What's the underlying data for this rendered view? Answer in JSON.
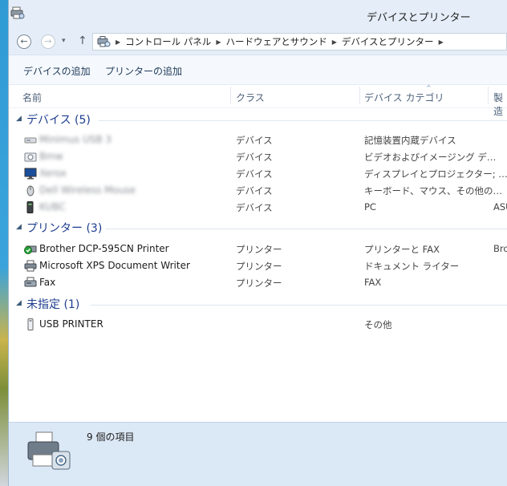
{
  "window": {
    "title": "デバイスとプリンター"
  },
  "nav": {
    "back_glyph": "←",
    "forward_glyph": "→",
    "dropdown_glyph": "▾",
    "up_glyph": "↑",
    "breadcrumb": [
      "コントロール パネル",
      "ハードウェアとサウンド",
      "デバイスとプリンター"
    ],
    "separator_glyph": "▶"
  },
  "commands": {
    "add_device": "デバイスの追加",
    "add_printer": "プリンターの追加"
  },
  "columns": {
    "name": "名前",
    "class": "クラス",
    "category": "デバイス カテゴリ",
    "maker": "製造"
  },
  "groups": [
    {
      "label": "デバイス (5)",
      "collapse_glyph": "◢",
      "items": [
        {
          "name": "Minimus USB 3",
          "class": "デバイス",
          "category": "記憶装置内蔵デバイス",
          "maker": "",
          "icon": "usb-drive-icon"
        },
        {
          "name": "Bmw",
          "class": "デバイス",
          "category": "ビデオおよびイメージング デ…",
          "maker": "",
          "icon": "camera-icon"
        },
        {
          "name": "Xerox",
          "class": "デバイス",
          "category": "ディスプレイとプロジェクター; …",
          "maker": "",
          "icon": "monitor-icon"
        },
        {
          "name": "Dell Wireless Mouse",
          "class": "デバイス",
          "category": "キーボード、マウス、その他の…",
          "maker": "",
          "icon": "mouse-icon"
        },
        {
          "name": "KUBC",
          "class": "デバイス",
          "category": "PC",
          "maker": "ASU",
          "icon": "pc-tower-icon"
        }
      ]
    },
    {
      "label": "プリンター (3)",
      "collapse_glyph": "◢",
      "items": [
        {
          "name": "Brother DCP-595CN Printer",
          "class": "プリンター",
          "category": "プリンターと FAX",
          "maker": "Bro",
          "icon": "default-printer-icon"
        },
        {
          "name": "Microsoft XPS Document Writer",
          "class": "プリンター",
          "category": "ドキュメント ライター",
          "maker": "",
          "icon": "printer-icon"
        },
        {
          "name": "Fax",
          "class": "プリンター",
          "category": "FAX",
          "maker": "",
          "icon": "fax-icon"
        }
      ]
    },
    {
      "label": "未指定 (1)",
      "collapse_glyph": "◢",
      "items": [
        {
          "name": "USB PRINTER",
          "class": "",
          "category": "その他",
          "maker": "",
          "icon": "usb-device-icon"
        }
      ]
    }
  ],
  "status": {
    "count_text": "9 個の項目"
  }
}
